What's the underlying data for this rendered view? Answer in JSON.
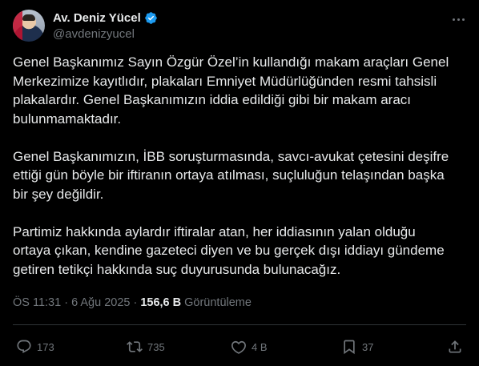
{
  "author": {
    "display_name": "Av. Deniz Yücel",
    "handle": "@avdenizyucel",
    "verified": true
  },
  "tweet": {
    "paragraphs": [
      "Genel Başkanımız Sayın Özgür Özel’in kullandığı makam araçları Genel\nMerkezimize kayıtlıdır, plakaları Emniyet Müdürlüğünden resmi tahsisli\nplakalardır. Genel Başkanımızın iddia edildiği gibi bir makam aracı\nbulunmamaktadır.",
      "Genel Başkanımızın, İBB soruşturmasında, savcı-avukat çetesini deşifre\nettiği gün böyle bir iftiranın ortaya atılması, suçluluğun telaşından başka\nbir şey değildir.",
      "Partimiz hakkında aylardır iftiralar atan, her iddiasının yalan olduğu\nortaya çıkan, kendine gazeteci diyen ve bu gerçek dışı iddiayı gündeme\ngetiren tetikçi hakkında suç duyurusunda bulunacağız."
    ]
  },
  "meta": {
    "timestamp": "ÖS 11:31 · 6 Ağu 2025 ·",
    "views_count": "156,6 B",
    "views_label": "Görüntüleme"
  },
  "actions": {
    "reply_count": "173",
    "retweet_count": "735",
    "like_count": "4 B",
    "bookmark_count": "37"
  },
  "colors": {
    "background": "#000000",
    "text": "#e7e9ea",
    "secondary": "#71767b",
    "verified": "#1d9bf0",
    "divider": "#2f3336"
  },
  "icons": [
    "verified-badge-icon",
    "more-options-icon",
    "reply-icon",
    "retweet-icon",
    "like-icon",
    "bookmark-icon",
    "share-icon"
  ]
}
